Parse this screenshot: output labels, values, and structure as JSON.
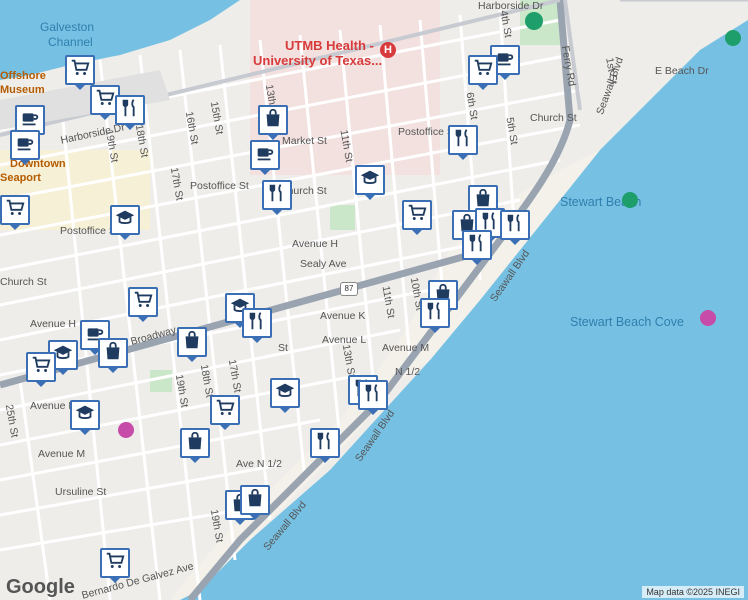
{
  "map": {
    "labels": {
      "water": [
        "Galveston",
        "Channel"
      ],
      "hospital": [
        "UTMB Health -",
        "University of Texas..."
      ],
      "museum": [
        "Offshore",
        "Museum"
      ],
      "downtown": [
        "Downtown",
        "Seaport"
      ],
      "stewart_beach": "Stewart Beach",
      "stewart_cove": "Stewart Beach Cove",
      "highway_shield": "87"
    },
    "streets": {
      "harborside_top": "Harborside Dr",
      "harborside_left": "Harborside Dr",
      "ferry": "Ferry Rd",
      "seawall_top": "Seawall Blvd",
      "seawall_mid": "Seawall Blvd",
      "seawall_mid2": "Seawall Blvd",
      "seawall_bottom": "Seawall Blvd",
      "st1": "1st St",
      "e_beach": "E Beach Dr",
      "st4": "4th St",
      "st5": "5th St",
      "st6": "6th St",
      "st10": "10th St",
      "st11": "11th St",
      "st11b": "11th St",
      "st13": "13th St",
      "st13b": "13th St",
      "st15": "15th St",
      "st16": "16th St",
      "st17": "17th St",
      "st17b": "17th St",
      "st18": "18th St",
      "st18b": "18th St",
      "st19": "19th St",
      "st19b": "19th St",
      "st19c": "19th St",
      "st25": "25th St",
      "church_r": "Church St",
      "church_m": "Church St",
      "church_l": "Church St",
      "postoffice_r": "Postoffice St",
      "postoffice_m": "Postoffice St",
      "postoffice_l": "Postoffice St",
      "market": "Market St",
      "avenue_h": "Avenue H",
      "avenue_h_left": "Avenue H",
      "sealy": "Sealy Ave",
      "avenue_k": "Avenue K",
      "avenue_k_left": "Avenue K",
      "avenue_l": "Avenue L",
      "avenue_m": "Avenue M",
      "avenue_m_left": "Avenue M",
      "avenue_n_half": "Ave N 1/2",
      "n_half_right": "N 1/2",
      "ursuline": "Ursuline St",
      "broadway": "Broadway",
      "bernardo": "Bernardo De Galvez Ave",
      "st_street": "St"
    },
    "markers": [
      {
        "icon": "cart"
      },
      {
        "icon": "cart"
      },
      {
        "icon": "coffee"
      },
      {
        "icon": "restaurant"
      },
      {
        "icon": "coffee"
      },
      {
        "icon": "cart"
      },
      {
        "icon": "school"
      },
      {
        "icon": "bag"
      },
      {
        "icon": "coffee"
      },
      {
        "icon": "restaurant"
      },
      {
        "icon": "school"
      },
      {
        "icon": "cart"
      },
      {
        "icon": "coffee"
      },
      {
        "icon": "cart"
      },
      {
        "icon": "restaurant"
      },
      {
        "icon": "bag"
      },
      {
        "icon": "bag"
      },
      {
        "icon": "restaurant"
      },
      {
        "icon": "restaurant"
      },
      {
        "icon": "restaurant"
      },
      {
        "icon": "bag"
      },
      {
        "icon": "restaurant"
      },
      {
        "icon": "cart"
      },
      {
        "icon": "school"
      },
      {
        "icon": "restaurant"
      },
      {
        "icon": "bag"
      },
      {
        "icon": "coffee"
      },
      {
        "icon": "school"
      },
      {
        "icon": "bag"
      },
      {
        "icon": "cart"
      },
      {
        "icon": "school"
      },
      {
        "icon": "cart"
      },
      {
        "icon": "school"
      },
      {
        "icon": "restaurant"
      },
      {
        "icon": "restaurant"
      },
      {
        "icon": "bag"
      },
      {
        "icon": "restaurant"
      },
      {
        "icon": "bag"
      },
      {
        "icon": "bag"
      },
      {
        "icon": "cart"
      }
    ],
    "logo": "Google",
    "attribution": "Map data ©2025 INEGI"
  }
}
